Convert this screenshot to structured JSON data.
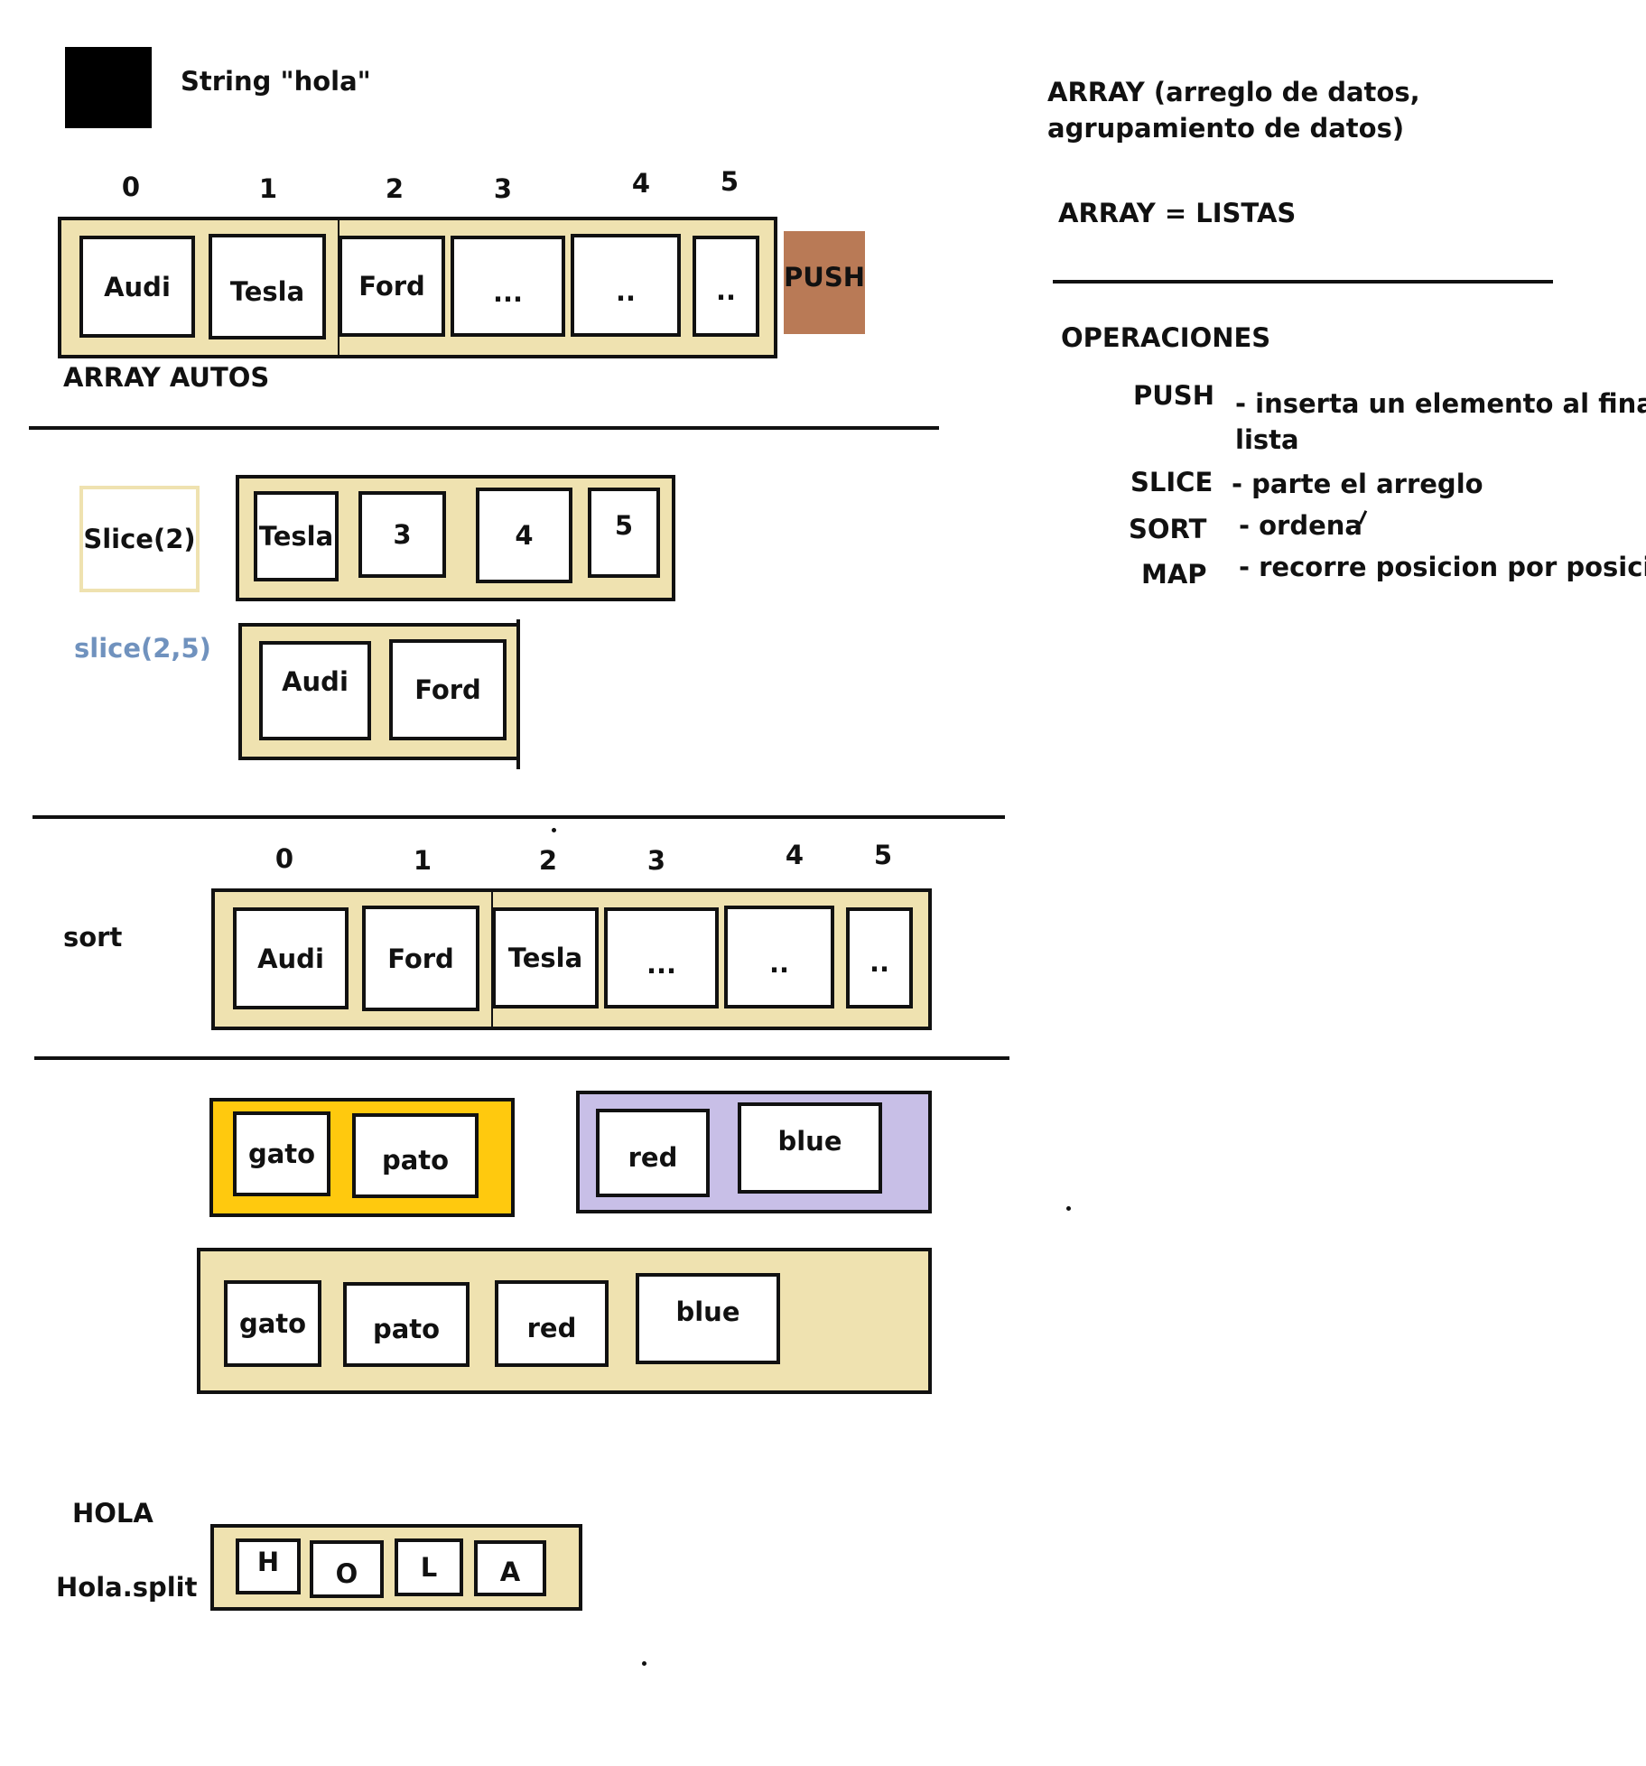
{
  "header": {
    "string_label": "String \"hola\""
  },
  "sidebar": {
    "title": "ARRAY (arreglo de datos,\nagrupamiento de datos)",
    "equals": "ARRAY = LISTAS",
    "operations_title": "OPERACIONES",
    "operations": [
      {
        "name": "PUSH",
        "desc": "- inserta un elemento al final de\nlista"
      },
      {
        "name": "SLICE",
        "desc": "- parte el arreglo"
      },
      {
        "name": "SORT",
        "desc": "- ordena"
      },
      {
        "name": "MAP",
        "desc": "- recorre posicion por posicion"
      }
    ]
  },
  "autos": {
    "indices": [
      "0",
      "1",
      "2",
      "3",
      "4",
      "5"
    ],
    "cells": [
      "Audi",
      "Tesla",
      "Ford",
      "...",
      "..",
      ".."
    ],
    "push_label": "PUSH",
    "caption": "ARRAY AUTOS"
  },
  "slice": {
    "box_label": "Slice(2)",
    "result_cells": [
      "Tesla",
      "3",
      "4",
      "5"
    ],
    "range_label": "slice(2,5)",
    "range_cells": [
      "Audi",
      "Ford"
    ]
  },
  "sort": {
    "label": "sort",
    "indices": [
      "0",
      "1",
      "2",
      "3",
      "4",
      "5"
    ],
    "cells": [
      "Audi",
      "Ford",
      "Tesla",
      "...",
      "..",
      ".."
    ]
  },
  "concat": {
    "array_a": [
      "gato",
      "pato"
    ],
    "array_b": [
      "red",
      "blue"
    ],
    "result": [
      "gato",
      "pato",
      "red",
      "blue"
    ]
  },
  "split": {
    "word": "HOLA",
    "call": "Hola.split",
    "letters": [
      "H",
      "O",
      "L",
      "A"
    ]
  },
  "colors": {
    "array_bg": "#efe2b0",
    "push_bg": "#b97a56",
    "slice_border": "#efe2b0",
    "slice_range_text": "#7092be",
    "array_a_bg": "#ffc90e",
    "array_b_bg": "#c8bfe7"
  }
}
